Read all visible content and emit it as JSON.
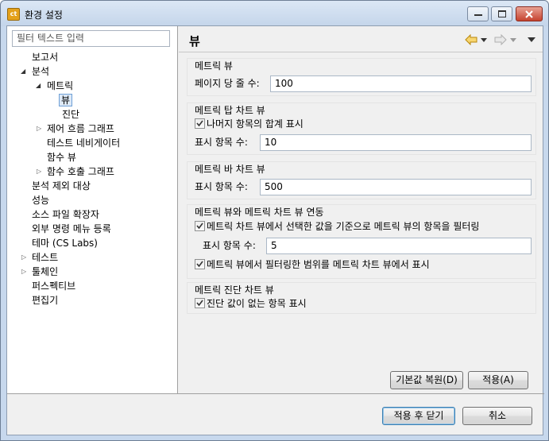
{
  "window": {
    "title": "환경 설정",
    "app_icon": "ct"
  },
  "filter": {
    "placeholder": "필터 텍스트 입력"
  },
  "tree": [
    {
      "label": "보고서"
    },
    {
      "label": "분석"
    },
    {
      "label": "메트릭"
    },
    {
      "label": "뷰"
    },
    {
      "label": "진단"
    },
    {
      "label": "제어 흐름 그래프"
    },
    {
      "label": "테스트 네비게이터"
    },
    {
      "label": "함수 뷰"
    },
    {
      "label": "함수 호출 그래프"
    },
    {
      "label": "분석 제외 대상"
    },
    {
      "label": "성능"
    },
    {
      "label": "소스 파일 확장자"
    },
    {
      "label": "외부 명령 메뉴 등록"
    },
    {
      "label": "테마 (CS Labs)"
    },
    {
      "label": "테스트"
    },
    {
      "label": "툴체인"
    },
    {
      "label": "퍼스펙티브"
    },
    {
      "label": "편집기"
    }
  ],
  "page": {
    "title": "뷰"
  },
  "groups": {
    "metric_view": {
      "title": "메트릭 뷰",
      "lines_label": "페이지 당 줄 수:",
      "lines_value": "100"
    },
    "top_chart": {
      "title": "메트릭 탑 차트 뷰",
      "show_rest_label": "나머지 항목의 합계 표시",
      "count_label": "표시 항목 수:",
      "count_value": "10"
    },
    "bar_chart": {
      "title": "메트릭 바 차트 뷰",
      "count_label": "표시 항목 수:",
      "count_value": "500"
    },
    "link": {
      "title": "메트릭 뷰와 메트릭 차트 뷰 연동",
      "filter_chart_label": "메트릭 차트 뷰에서 선택한 값을 기준으로 메트릭 뷰의 항목을 필터링",
      "count_label": "표시 항목 수:",
      "count_value": "5",
      "show_range_label": "메트릭 뷰에서 필터링한 범위를 메트릭 차트 뷰에서 표시"
    },
    "diag_chart": {
      "title": "메트릭 진단 차트 뷰",
      "show_no_value_label": "진단 값이 없는 항목 표시"
    }
  },
  "buttons": {
    "restore": "기본값 복원(D)",
    "apply": "적용(A)",
    "apply_close": "적용 후 닫기",
    "cancel": "취소"
  },
  "colors": {
    "accent": "#e4a11b",
    "selection_border": "#6fa0d6"
  }
}
